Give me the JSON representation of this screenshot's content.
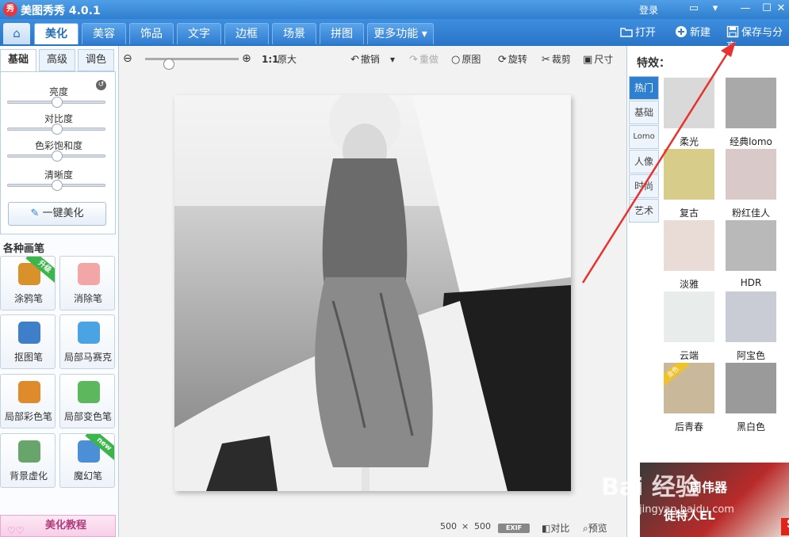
{
  "window": {
    "app_title": "美图秀秀 4.0.1",
    "logo_text": "秀",
    "login_label": "登录"
  },
  "tabs": [
    "美化",
    "美容",
    "饰品",
    "文字",
    "边框",
    "场景",
    "拼图"
  ],
  "tab_more": "更多功能",
  "top_actions": {
    "open": "打开",
    "new": "新建",
    "save": "保存与分享"
  },
  "left": {
    "subtabs": [
      "基础",
      "高级",
      "调色"
    ],
    "sliders": [
      {
        "label": "亮度",
        "value": 0.5
      },
      {
        "label": "对比度",
        "value": 0.5
      },
      {
        "label": "色彩饱和度",
        "value": 0.5
      },
      {
        "label": "清晰度",
        "value": 0.5
      }
    ],
    "one_key": "一键美化",
    "brushes_title": "各种画笔",
    "brushes": [
      {
        "label": "涂鸦笔",
        "badge": "升级",
        "icon": "paint-brush-icon",
        "color": "#d9912c"
      },
      {
        "label": "消除笔",
        "badge": "",
        "icon": "eraser-icon",
        "color": "#f2a6a6"
      },
      {
        "label": "抠图笔",
        "badge": "",
        "icon": "cutout-pen-icon",
        "color": "#3f7fc9"
      },
      {
        "label": "局部马赛克",
        "badge": "",
        "icon": "mosaic-icon",
        "color": "#4aa4e4"
      },
      {
        "label": "局部彩色笔",
        "badge": "",
        "icon": "color-brush-icon",
        "color": "#e08b2b"
      },
      {
        "label": "局部变色笔",
        "badge": "",
        "icon": "recolor-brush-icon",
        "color": "#5cb85c"
      },
      {
        "label": "背景虚化",
        "badge": "",
        "icon": "background-blur-icon",
        "color": "#67a56b"
      },
      {
        "label": "魔幻笔",
        "badge": "new",
        "icon": "magic-pen-icon",
        "color": "#4b8fd6"
      }
    ],
    "tutorial": "美化教程"
  },
  "canvas": {
    "zoom_original": "1:1",
    "original_size": "原大",
    "tools": {
      "undo": "撤销",
      "redo": "重做",
      "original": "原图",
      "rotate": "旋转",
      "crop": "裁剪",
      "resize": "尺寸"
    },
    "image_width": "500",
    "image_height": "500",
    "size_sep": "×",
    "exif": "EXIF",
    "compare": "对比",
    "preview": "预览"
  },
  "right": {
    "title": "特效：",
    "categories": [
      "热门",
      "基础",
      "Lomo",
      "人像",
      "时尚",
      "艺术"
    ],
    "effects": [
      {
        "label": "柔光",
        "tone": "#d9d9d9"
      },
      {
        "label": "经典lomo",
        "tone": "#a9a9a9"
      },
      {
        "label": "复古",
        "tone": "#d8cc8a"
      },
      {
        "label": "粉红佳人",
        "tone": "#d9c9c9"
      },
      {
        "label": "淡雅",
        "tone": "#e9dcd6"
      },
      {
        "label": "HDR",
        "tone": "#b9b9b9"
      },
      {
        "label": "云端",
        "tone": "#e8ecea"
      },
      {
        "label": "阿宝色",
        "tone": "#c9ccd4"
      },
      {
        "label": "后青春",
        "tone": "#c9b99a",
        "badge": "金色"
      },
      {
        "label": "黑白色",
        "tone": "#9a9a9a"
      }
    ],
    "ad": {
      "line1": "周伟器",
      "line2": "徒特人EL",
      "badge": "S"
    }
  },
  "watermark": {
    "main": "Bai 经验",
    "sub": "jingyan.baidu.com"
  },
  "colors": {
    "accent": "#2f7fcf",
    "arrow": "#e8322f"
  }
}
